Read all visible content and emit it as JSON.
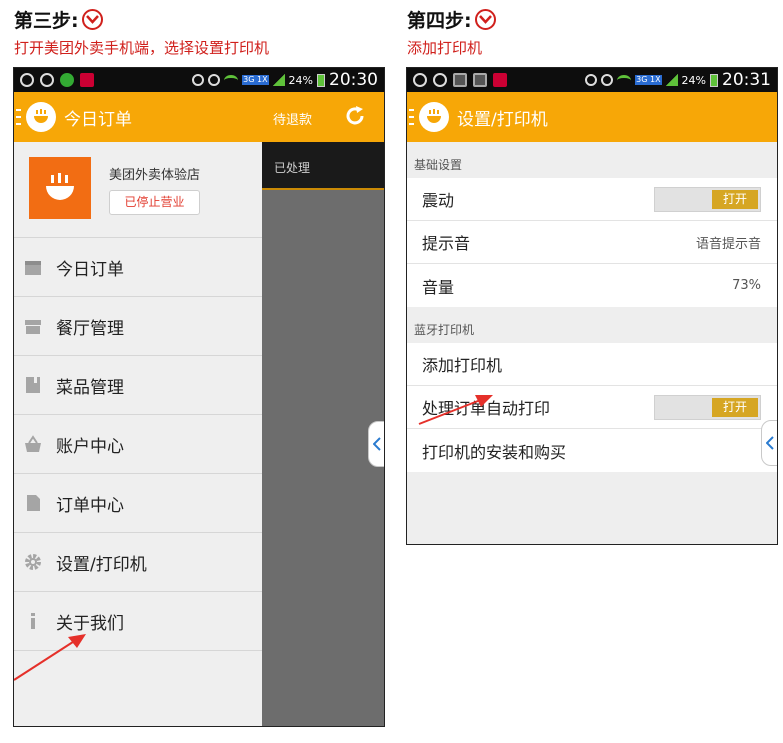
{
  "step3": {
    "title": "第三步:",
    "subtitle": "打开美团外卖手机端，选择设置打印机"
  },
  "step4": {
    "title": "第四步:",
    "subtitle": "添加打印机"
  },
  "phone1": {
    "status_bar": {
      "battery": "24%",
      "time": "20:30",
      "network": "3G 1X"
    },
    "app_bar": {
      "title": "今日订单",
      "action": "待退款"
    },
    "store": {
      "name": "美团外卖体验店",
      "status_button": "已停止营业"
    },
    "menu": [
      {
        "label": "今日订单",
        "icon": "calendar-icon"
      },
      {
        "label": "餐厅管理",
        "icon": "shop-icon"
      },
      {
        "label": "菜品管理",
        "icon": "book-icon"
      },
      {
        "label": "账户中心",
        "icon": "basket-icon"
      },
      {
        "label": "订单中心",
        "icon": "document-icon"
      },
      {
        "label": "设置/打印机",
        "icon": "gear-icon"
      },
      {
        "label": "关于我们",
        "icon": "info-icon"
      }
    ],
    "overlay_tab": "已处理"
  },
  "phone2": {
    "status_bar": {
      "battery": "24%",
      "time": "20:31",
      "network": "3G 1X"
    },
    "app_bar": {
      "title": "设置/打印机"
    },
    "basic_section": {
      "header": "基础设置",
      "vibrate": {
        "label": "震动",
        "toggle": "打开"
      },
      "sound": {
        "label": "提示音",
        "value": "语音提示音"
      },
      "volume": {
        "label": "音量",
        "value": "73%"
      }
    },
    "bluetooth_section": {
      "header": "蓝牙打印机",
      "add_printer": {
        "label": "添加打印机"
      },
      "auto_print": {
        "label": "处理订单自动打印",
        "toggle": "打开"
      },
      "install_buy": {
        "label": "打印机的安装和购买"
      }
    }
  },
  "colors": {
    "accent": "#f7a707",
    "step_red": "#d0201c",
    "toggle_on": "#d6a623",
    "status_stopped": "#e23b2e"
  }
}
